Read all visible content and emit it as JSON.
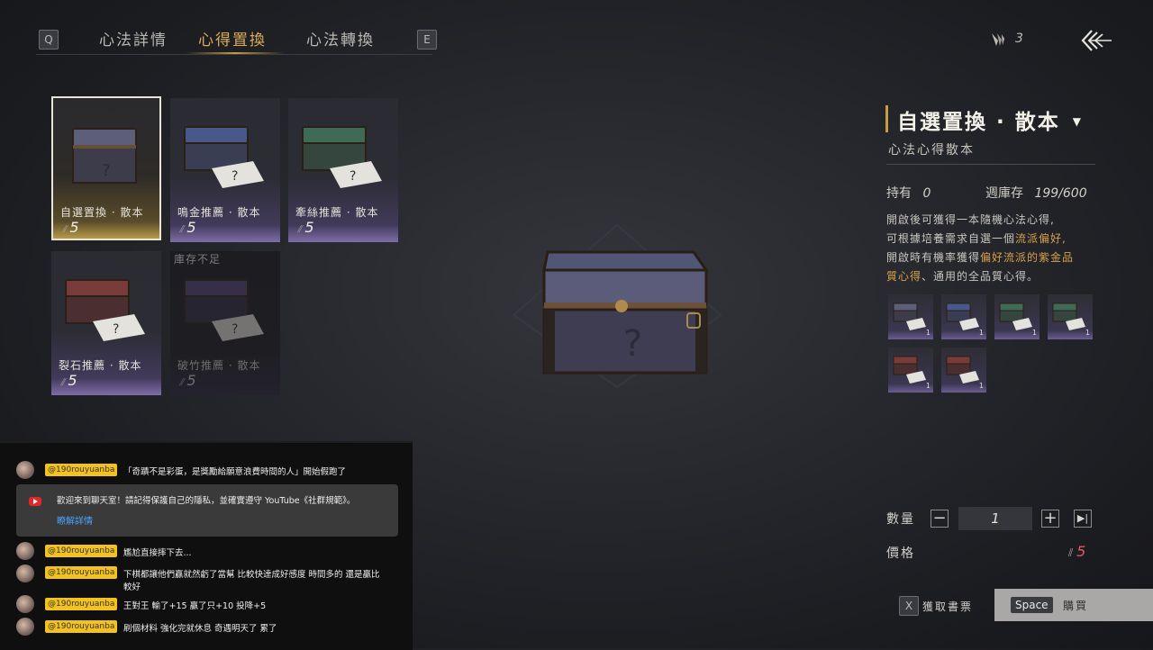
{
  "tabs": {
    "left_key": "Q",
    "right_key": "E",
    "items": [
      {
        "label": "心法詳情",
        "active": false
      },
      {
        "label": "心得置換",
        "active": true
      },
      {
        "label": "心法轉換",
        "active": false
      }
    ]
  },
  "currency": {
    "icon": "quill-currency-icon",
    "count": "3"
  },
  "back_icon": "back-arrows-icon",
  "grid": {
    "items": [
      {
        "name": "自選置換 · 散本",
        "price": "5",
        "selected": true,
        "chest_color": "#5b5f7a"
      },
      {
        "name": "鳴金推薦 · 散本",
        "price": "5",
        "selected": false,
        "chest_color": "#47598a"
      },
      {
        "name": "牽絲推薦 · 散本",
        "price": "5",
        "selected": false,
        "chest_color": "#3f6a55"
      },
      {
        "name": "裂石推薦 · 散本",
        "price": "5",
        "selected": false,
        "chest_color": "#7a3c3a"
      },
      {
        "name": "破竹推薦 · 散本",
        "price": "5",
        "selected": false,
        "disabled": true,
        "stock_note": "庫存不足",
        "chest_color": "#4a3e66"
      }
    ]
  },
  "detail": {
    "title": "自選置換 · 散本",
    "subtitle": "心法心得散本",
    "owned_label": "持有",
    "owned_value": "0",
    "weekly_label": "週庫存",
    "weekly_value": "199/600",
    "desc_line1": "開啟後可獲得一本隨機心法心得,",
    "desc_line2a": "可根據培養需求自選一個",
    "desc_line2b": "流派偏好,",
    "desc_line3a": "開啟時有機率獲得",
    "desc_line3b": "偏好流派的紫金品",
    "desc_line4a": "質心得",
    "desc_line4b": "、通用的全品質心得。",
    "rewards": [
      {
        "color": "#5b5f7a",
        "count": "1"
      },
      {
        "color": "#47598a",
        "count": "1"
      },
      {
        "color": "#3f6a55",
        "count": "1"
      },
      {
        "color": "#3f6a55",
        "count": "1"
      },
      {
        "color": "#7a3c3a",
        "count": "1"
      },
      {
        "color": "#7a3c3a",
        "count": "1"
      }
    ]
  },
  "purchase": {
    "qty_label": "數量",
    "qty_value": "1",
    "price_label": "價格",
    "price_value": "5",
    "price_color": "#e0566a",
    "get_key": "X",
    "get_label": "獲取書票",
    "buy_key": "Space",
    "buy_label": "購買"
  },
  "chat": {
    "messages": [
      {
        "user": "@190rouyuanba",
        "text": "「奇蹟不是彩蛋，是獎勵給願意浪費時間的人」開始假跑了"
      },
      {
        "user": "@190rouyuanba",
        "text": "尷尬直接摔下去..."
      },
      {
        "user": "@190rouyuanba",
        "text": "下棋都讓他們贏就然虧了當幫 比較快達成好感度 時間多的 還是贏比"
      },
      {
        "user": "@190rouyuanba",
        "text": "王對王 輸了+15 贏了只+10 投降+5"
      },
      {
        "user": "@190rouyuanba",
        "text": "刷個材料 強化完就休息 奇遇明天了 累了"
      }
    ],
    "wrap_text": "較好",
    "notice_text": "歡迎來到聊天室！請記得保護自己的隱私，並確實遵守 YouTube《社群規範》。",
    "notice_link": "瞭解詳情"
  }
}
